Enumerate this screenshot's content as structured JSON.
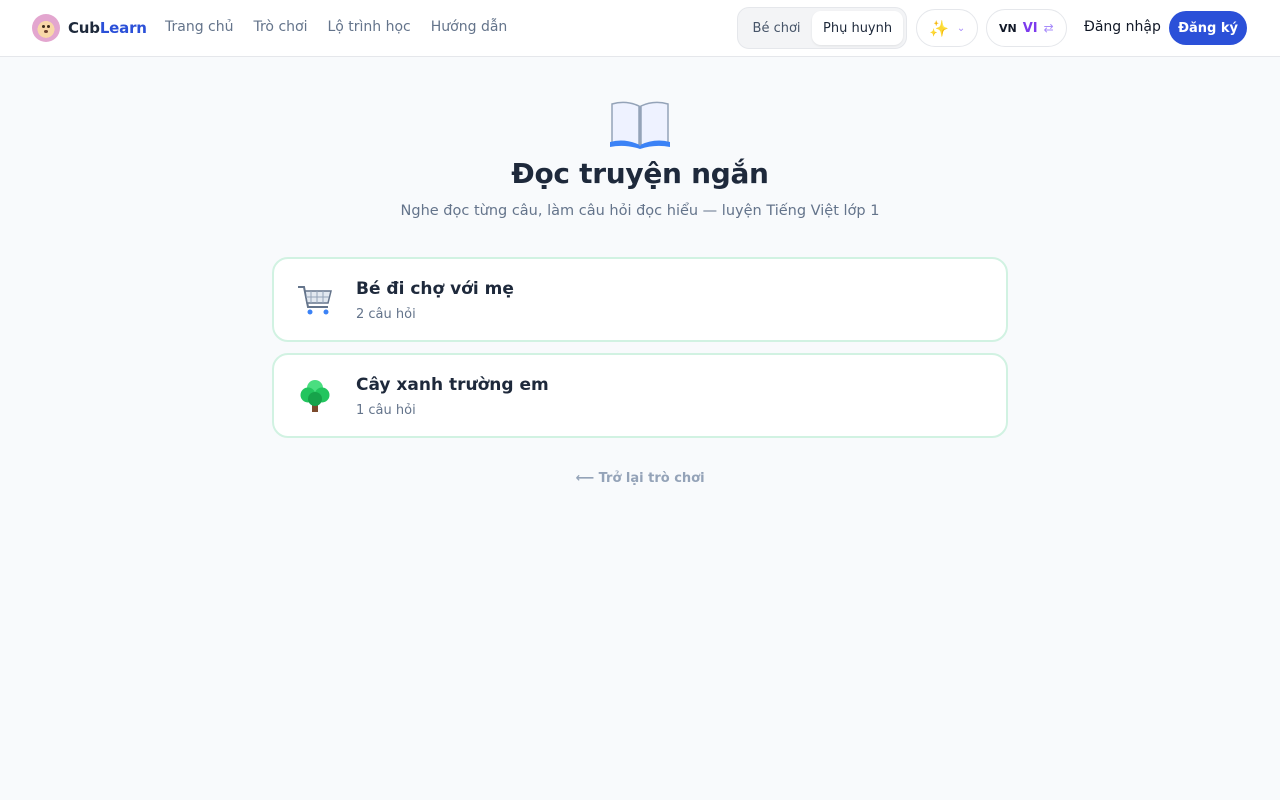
{
  "brand": {
    "part1": "Cub",
    "part2": "Learn"
  },
  "nav": [
    {
      "label": "Trang chủ"
    },
    {
      "label": "Trò chơi"
    },
    {
      "label": "Lộ trình học"
    },
    {
      "label": "Hướng dẫn"
    }
  ],
  "mode_toggle": {
    "kid": "Bé chơi",
    "parent": "Phụ huynh",
    "active": "parent"
  },
  "theme_icon": "sparkles-icon",
  "language": {
    "flag": "VN",
    "code": "VI"
  },
  "auth": {
    "login": "Đăng nhập",
    "signup": "Đăng ký"
  },
  "page": {
    "icon": "open-book-icon",
    "title": "Đọc truyện ngắn",
    "subtitle": "Nghe đọc từng câu, làm câu hỏi đọc hiểu — luyện Tiếng Việt lớp 1"
  },
  "stories": [
    {
      "icon": "shopping-cart-icon",
      "title": "Bé đi chợ với mẹ",
      "meta": "2 câu hỏi"
    },
    {
      "icon": "tree-icon",
      "title": "Cây xanh trường em",
      "meta": "1 câu hỏi"
    }
  ],
  "back_link": "⟵ Trở lại trò chơi",
  "colors": {
    "primary": "#2b50d8",
    "card_border": "#d1f2e2",
    "background": "#f8fafc"
  }
}
